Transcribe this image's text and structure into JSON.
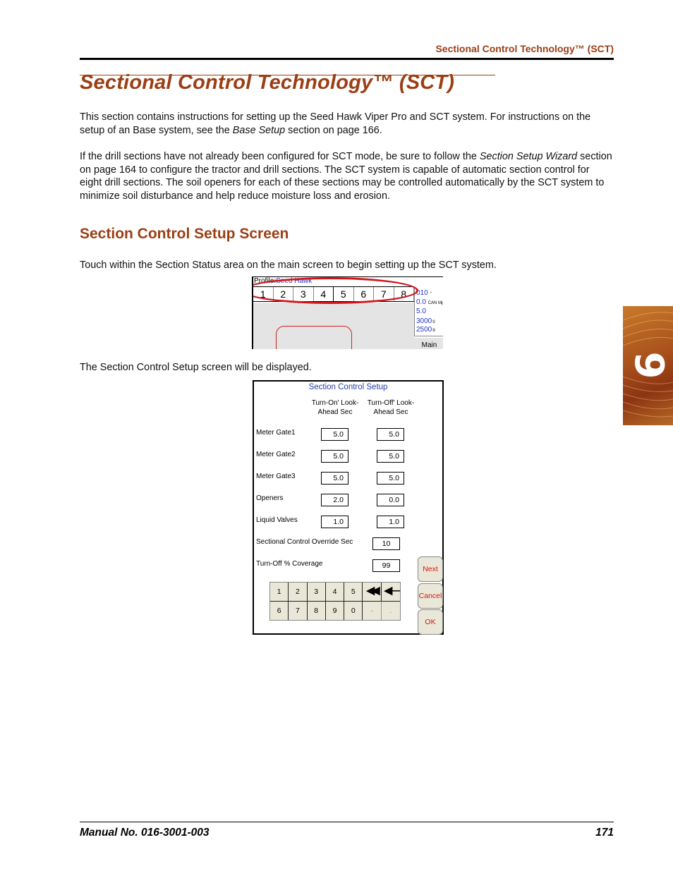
{
  "header": {
    "running_title": "Sectional Control Technology™ (SCT)"
  },
  "page_title": "Sectional Control Technology™ (SCT)",
  "intro": {
    "p1_a": "This section contains instructions for setting up the Seed Hawk Viper Pro and SCT system. For instructions on the setup of an Base system, see the ",
    "p1_em": "Base Setup",
    "p1_b": " section on page 166.",
    "p2_a": "If the drill sections have not already been configured for SCT mode, be sure to follow the ",
    "p2_em": "Section Setup Wizard",
    "p2_b": " section on page 164 to configure the tractor and drill sections. The SCT system is capable of automatic section control for eight drill sections. The soil openers for each of these sections may be controlled automatically by the SCT system to minimize soil disturbance and help reduce moisture loss and erosion."
  },
  "section": {
    "heading": "Section Control Setup Screen",
    "p3": "Touch within the Section Status area on the main screen to begin setting up the SCT system.",
    "p4": "The Section Control Setup screen will be displayed."
  },
  "main_screen": {
    "profile_label": "Profile:",
    "profile_value": "Seed Hawk",
    "sections": [
      "1",
      "2",
      "3",
      "4",
      "5",
      "6",
      "7",
      "8"
    ],
    "stats": [
      {
        "value": "010",
        "unit": "°"
      },
      {
        "value": "0.0",
        "unit": "CAN Mph"
      },
      {
        "value": "5.0",
        "unit": ""
      },
      {
        "value": "3000",
        "unit": "①"
      },
      {
        "value": "2500",
        "unit": "②"
      }
    ],
    "main_button": "Main"
  },
  "setup_screen": {
    "title": "Section Control Setup",
    "col_on": "Turn-On' Look-Ahead Sec",
    "col_off": "Turn-Off' Look-Ahead Sec",
    "rows": [
      {
        "label": "Meter Gate1",
        "on": "5.0",
        "off": "5.0"
      },
      {
        "label": "Meter Gate2",
        "on": "5.0",
        "off": "5.0"
      },
      {
        "label": "Meter Gate3",
        "on": "5.0",
        "off": "5.0"
      },
      {
        "label": "Openers",
        "on": "2.0",
        "off": "0.0"
      },
      {
        "label": "Liquid Valves",
        "on": "1.0",
        "off": "1.0"
      }
    ],
    "override_label": "Sectional Control Override Sec",
    "override_value": "10",
    "coverage_label": "Turn-Off % Coverage",
    "coverage_value": "99",
    "keypad": [
      "1",
      "2",
      "3",
      "4",
      "5",
      "◀◀",
      "◀—",
      "6",
      "7",
      "8",
      "9",
      "0",
      "-",
      "."
    ],
    "buttons": {
      "next": "Next",
      "cancel": "Cancel",
      "ok": "OK"
    }
  },
  "footer": {
    "manual": "Manual No. 016-3001-003",
    "page": "171"
  },
  "chapter_tab": "9",
  "colors": {
    "accent": "#9c3e14",
    "screen_blue": "#2a3fa8",
    "button_red": "#e01010"
  }
}
